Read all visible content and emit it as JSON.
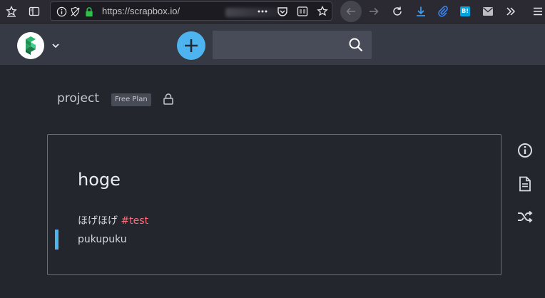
{
  "browser": {
    "url": "https://scrapbox.io/",
    "url_obscured": true
  },
  "header": {
    "new_page_icon": "plus-icon",
    "search": {
      "value": "",
      "placeholder": ""
    }
  },
  "project": {
    "name": "project",
    "plan": "Free Plan",
    "visibility_icon": "lock-icon"
  },
  "page": {
    "title": "hoge",
    "lines": [
      {
        "text": "ほげほげ ",
        "hashtag": "#test"
      },
      {
        "text": "pukupuku"
      }
    ]
  },
  "side_actions": [
    {
      "icon": "info-icon"
    },
    {
      "icon": "document-icon"
    },
    {
      "icon": "shuffle-icon"
    }
  ],
  "colors": {
    "accent": "#4db4f0",
    "hashtag": "#ff6b7a",
    "background": "#23262d",
    "header": "#363a45"
  }
}
